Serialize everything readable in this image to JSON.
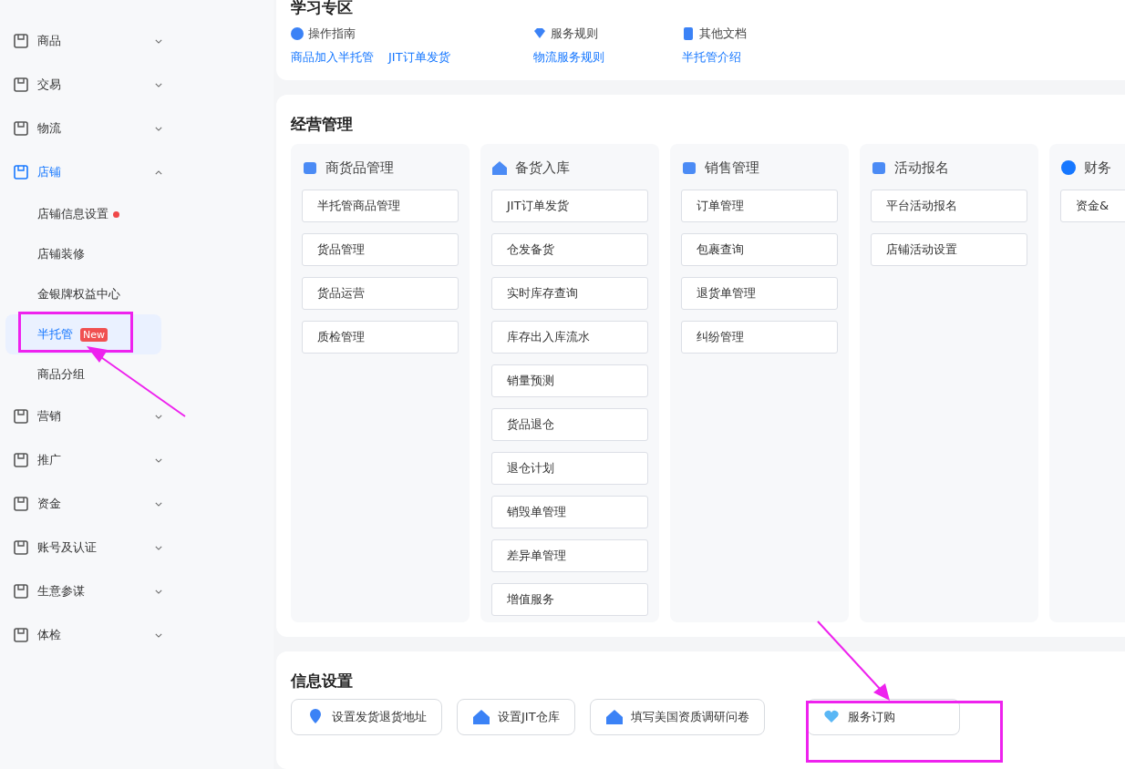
{
  "sidebar": {
    "items": [
      {
        "label": "商品",
        "expanded": false,
        "active": false
      },
      {
        "label": "交易",
        "expanded": false,
        "active": false
      },
      {
        "label": "物流",
        "expanded": false,
        "active": false
      },
      {
        "label": "店铺",
        "expanded": true,
        "active": true,
        "children": [
          {
            "label": "店铺信息设置",
            "selected": false,
            "dot": true
          },
          {
            "label": "店铺装修",
            "selected": false,
            "dot": false
          },
          {
            "label": "金银牌权益中心",
            "selected": false,
            "dot": false
          },
          {
            "label": "半托管",
            "selected": true,
            "dot": false,
            "badge": "New"
          },
          {
            "label": "商品分组",
            "selected": false,
            "dot": false
          }
        ]
      },
      {
        "label": "营销",
        "expanded": false,
        "active": false
      },
      {
        "label": "推广",
        "expanded": false,
        "active": false
      },
      {
        "label": "资金",
        "expanded": false,
        "active": false
      },
      {
        "label": "账号及认证",
        "expanded": false,
        "active": false
      },
      {
        "label": "生意参谋",
        "expanded": false,
        "active": false
      },
      {
        "label": "体检",
        "expanded": false,
        "active": false
      }
    ]
  },
  "learning": {
    "title": "学习专区",
    "groups": [
      {
        "title": "操作指南",
        "links": [
          "商品加入半托管",
          "JIT订单发货"
        ]
      },
      {
        "title": "服务规则",
        "links": [
          "物流服务规则"
        ]
      },
      {
        "title": "其他文档",
        "links": [
          "半托管介绍"
        ]
      }
    ]
  },
  "management": {
    "title": "经营管理",
    "columns": [
      {
        "title": "商货品管理",
        "items": [
          "半托管商品管理",
          "货品管理",
          "货品运营",
          "质检管理"
        ]
      },
      {
        "title": "备货入库",
        "items": [
          "JIT订单发货",
          "仓发备货",
          "实时库存查询",
          "库存出入库流水",
          "销量预测",
          "货品退仓",
          "退仓计划",
          "销毁单管理",
          "差异单管理",
          "增值服务"
        ]
      },
      {
        "title": "销售管理",
        "items": [
          "订单管理",
          "包裹查询",
          "退货单管理",
          "纠纷管理"
        ]
      },
      {
        "title": "活动报名",
        "items": [
          "平台活动报名",
          "店铺活动设置"
        ]
      },
      {
        "title": "财务",
        "items": [
          "资金&"
        ]
      }
    ]
  },
  "info_settings": {
    "title": "信息设置",
    "buttons": [
      "设置发货退货地址",
      "设置JIT仓库",
      "填写美国资质调研问卷",
      "服务订购"
    ]
  }
}
